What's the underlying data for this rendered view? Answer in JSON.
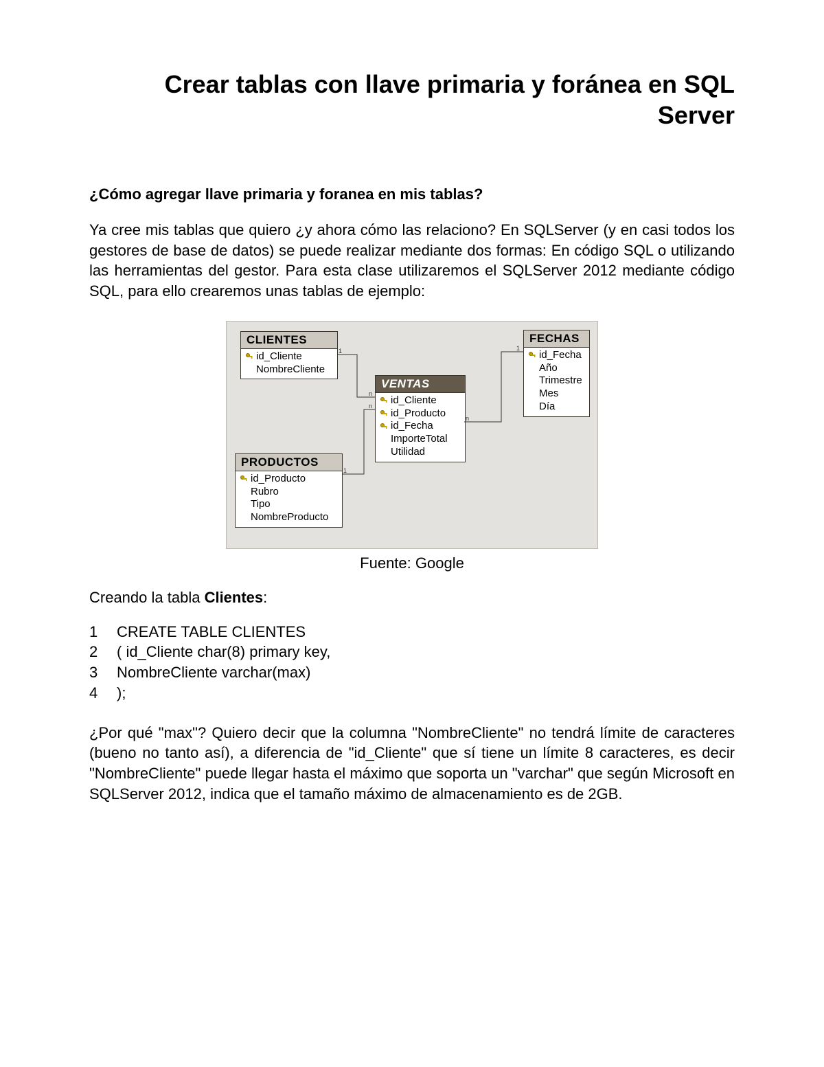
{
  "title": "Crear tablas con llave primaria y foránea en SQL Server",
  "subheading": "¿Cómo agregar llave primaria y foranea en mis tablas?",
  "intro_para": "Ya cree mis tablas que quiero ¿y ahora cómo las relaciono? En SQLServer (y en casi todos los gestores de base de datos) se puede realizar mediante dos formas: En código SQL o utilizando las herramientas del gestor. Para esta clase utilizaremos el SQLServer 2012 mediante código SQL, para ello crearemos unas tablas de ejemplo:",
  "diagram": {
    "caption": "Fuente: Google",
    "tables": {
      "clientes": {
        "header": "CLIENTES",
        "cols": [
          "id_Cliente",
          "NombreCliente"
        ],
        "keys": [
          true,
          false
        ]
      },
      "ventas": {
        "header": "VENTAS",
        "cols": [
          "id_Cliente",
          "id_Producto",
          "id_Fecha",
          "ImporteTotal",
          "Utilidad"
        ],
        "keys": [
          true,
          true,
          true,
          false,
          false
        ]
      },
      "productos": {
        "header": "PRODUCTOS",
        "cols": [
          "id_Producto",
          "Rubro",
          "Tipo",
          "NombreProducto"
        ],
        "keys": [
          true,
          false,
          false,
          false
        ]
      },
      "fechas": {
        "header": "FECHAS",
        "cols": [
          "id_Fecha",
          "Año",
          "Trimestre",
          "Mes",
          "Día"
        ],
        "keys": [
          true,
          false,
          false,
          false,
          false
        ]
      }
    },
    "markers": {
      "one": "1",
      "many": "n"
    }
  },
  "creating_prefix": "Creando la tabla ",
  "creating_bold": "Clientes",
  "creating_suffix": ":",
  "code": {
    "l1": {
      "n": "1",
      "t": "CREATE TABLE CLIENTES"
    },
    "l2": {
      "n": "2",
      "t": "( id_Cliente char(8) primary key,"
    },
    "l3": {
      "n": "3",
      "t": "NombreCliente varchar(max)"
    },
    "l4": {
      "n": "4",
      "t": ");"
    }
  },
  "explain_para": "¿Por qué \"max\"? Quiero decir que la columna \"NombreCliente\" no tendrá límite de caracteres (bueno no tanto así), a diferencia de \"id_Cliente\" que sí tiene un límite 8 caracteres, es decir \"NombreCliente\" puede llegar hasta el máximo que soporta un \"varchar\" que según Microsoft en SQLServer 2012, indica que el tamaño máximo de almacenamiento es de 2GB."
}
